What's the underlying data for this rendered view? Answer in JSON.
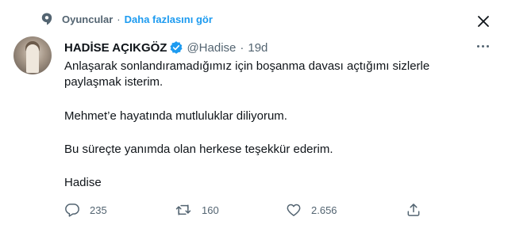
{
  "topic": {
    "name": "Oyuncular",
    "separator": "·",
    "more_link": "Daha fazlasını gör"
  },
  "tweet": {
    "display_name": "HADİSE AÇIKGÖZ",
    "handle": "@Hadise",
    "separator": "·",
    "time": "19d",
    "verified": true,
    "paragraphs": [
      "Anlaşarak sonlandıramadığımız için boşanma davası açtığımı sizlerle paylaşmak isterim.",
      "Mehmet’e hayatında mutluluklar diliyorum.",
      "Bu süreçte yanımda olan herkese teşekkür ederim.",
      "Hadise"
    ]
  },
  "actions": {
    "replies": "235",
    "retweets": "160",
    "likes": "2.656"
  },
  "colors": {
    "accent": "#1d9bf0",
    "text": "#0f1419",
    "secondary": "#536471"
  },
  "icons": {
    "topic": "topic-icon",
    "close": "close-icon",
    "verified": "verified-badge-icon",
    "more": "more-options-icon",
    "reply": "reply-icon",
    "retweet": "retweet-icon",
    "like": "like-icon",
    "share": "share-icon"
  }
}
